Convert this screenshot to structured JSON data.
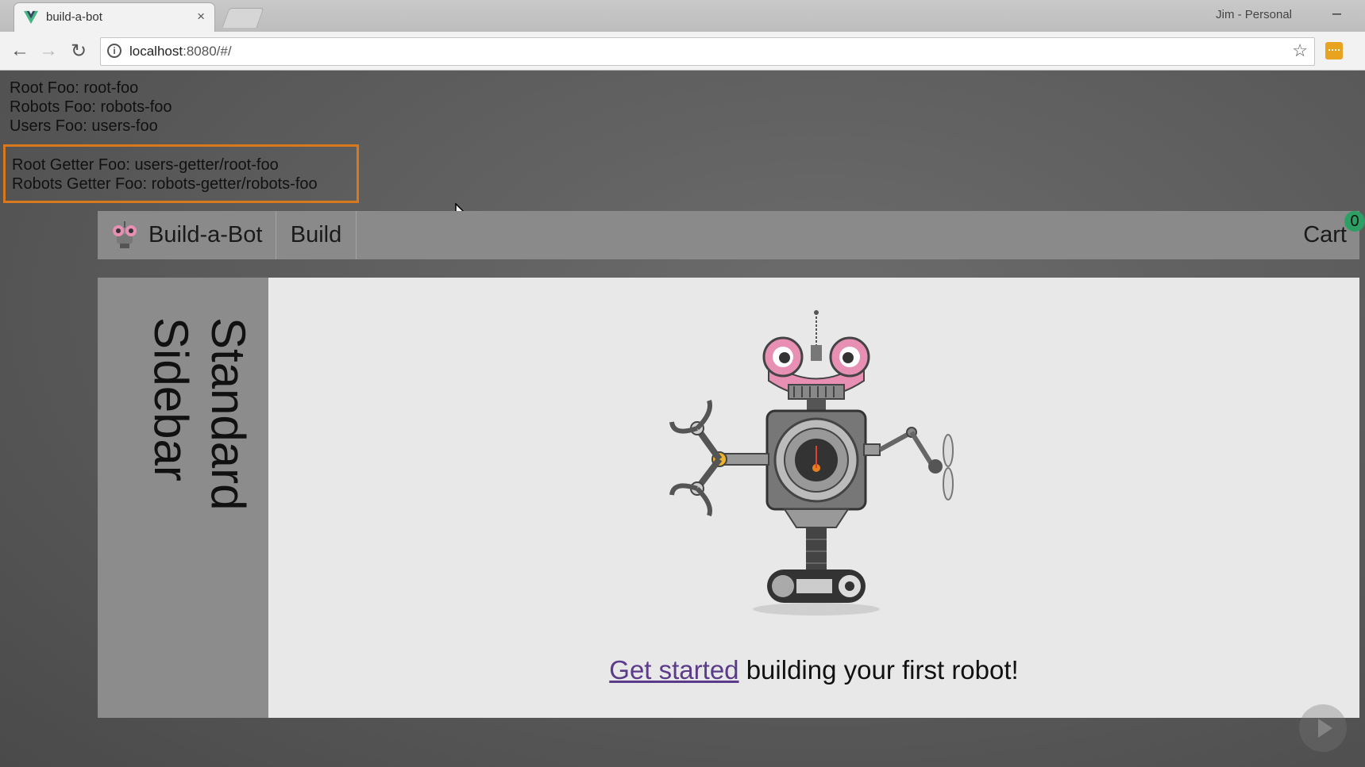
{
  "browser": {
    "tab_title": "build-a-bot",
    "tab_close": "×",
    "profile": "Jim - Personal",
    "minimize": "–",
    "url_host": "localhost",
    "url_rest": ":8080/#/",
    "back": "←",
    "forward": "→",
    "reload": "↻",
    "star": "☆",
    "info": "i"
  },
  "debug": {
    "root_foo": "Root Foo: root-foo",
    "robots_foo": "Robots Foo: robots-foo",
    "users_foo": "Users Foo: users-foo",
    "root_getter_foo": "Root Getter Foo: users-getter/root-foo",
    "robots_getter_foo": "Robots Getter Foo: robots-getter/robots-foo"
  },
  "header": {
    "home_label": "Build-a-Bot",
    "build_label": "Build",
    "cart_label": "Cart",
    "cart_count": "0"
  },
  "sidebar": {
    "title": "Standard Sidebar"
  },
  "main": {
    "link_text": "Get started",
    "tagline_rest": " building your first robot!"
  },
  "colors": {
    "highlight_box": "#d9781c",
    "cart_badge": "#2d9f64",
    "link": "#5b3b8a"
  }
}
